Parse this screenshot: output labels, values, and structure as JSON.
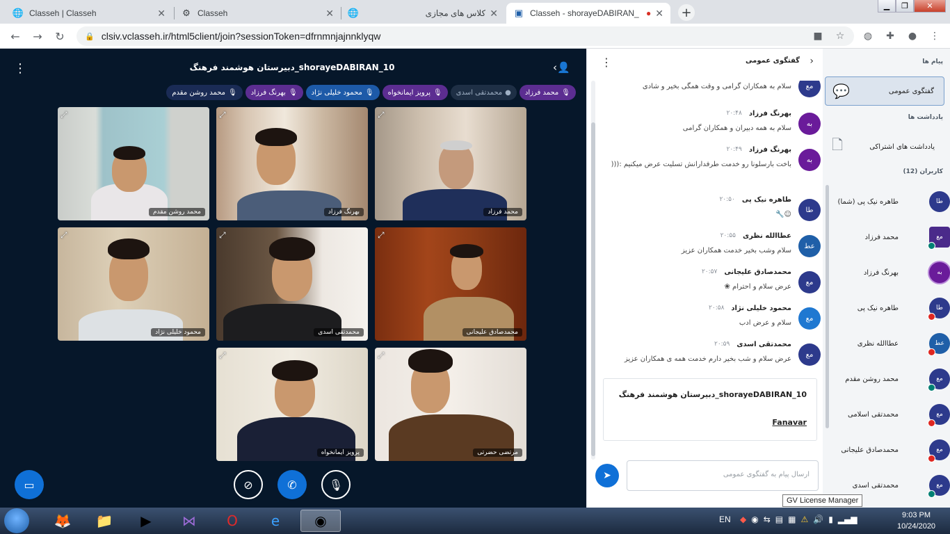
{
  "browser": {
    "tabs": [
      {
        "title": "Classeh | Classeh",
        "icon": "globe-icon"
      },
      {
        "title": "Classeh",
        "icon": "classeh-icon"
      },
      {
        "title": "کلاس های مجازی",
        "icon": "globe-icon"
      },
      {
        "title": "Classeh - shorayeDABIRAN_",
        "icon": "classeh-icon",
        "active": true,
        "recording": true
      }
    ],
    "url": "clsiv.vclasseh.ir/html5client/join?sessionToken=dfrnmnjajnnklyqw"
  },
  "session": {
    "title": "shorayeDABIRAN_10_دبیرستان هوشمند فرهنگ"
  },
  "talkers": [
    {
      "name": "محمد فرزاد",
      "style": "purple"
    },
    {
      "name": "محمدتقی اسدی",
      "style": "muted"
    },
    {
      "name": "پرویز ایمانخواه",
      "style": "purple"
    },
    {
      "name": "محمود خلیلی نژاد",
      "style": "dark-blue"
    },
    {
      "name": "بهرنگ فرزاد",
      "style": "purple"
    },
    {
      "name": "محمد روشن مقدم",
      "style": "dark"
    }
  ],
  "videos": [
    {
      "name": "محمد روشن مقدم"
    },
    {
      "name": "بهرنگ فرزاد"
    },
    {
      "name": "محمد فرزاد"
    },
    {
      "name": "محمود خلیلی نژاد"
    },
    {
      "name": "محمدتقی اسدی"
    },
    {
      "name": "محمدصادق علیجانی"
    },
    {
      "name": "پرویز ایمانخواه"
    },
    {
      "name": "مرتضی حضرتی"
    }
  ],
  "chat": {
    "title": "گفتگوی عمومی",
    "messages": [
      {
        "avatar": "مع",
        "sender": "",
        "time": "",
        "text": "سلام به همکاران گرامی و وقت همگی بخیر و شادی"
      },
      {
        "avatar": "به",
        "sender": "بهرنگ فرزاد",
        "time": "۲۰:۴۸",
        "text": "سلام به همه دبیران و همکاران گرامی"
      },
      {
        "avatar": "به",
        "sender": "بهرنگ فرزاد",
        "time": "۲۰:۴۹",
        "text": "باخت بارسلونا رو خدمت طرفدارانش تسلیت عرض میکنیم :((("
      },
      {
        "avatar": "طا",
        "sender": "طاهره نیک پی",
        "time": "۲۰:۵۰",
        "text": "☺🔧"
      },
      {
        "avatar": "عط",
        "sender": "عطاالله نظری",
        "time": "۲۰:۵۵",
        "text": "سلام وشب بخیر خدمت همکاران عزیز"
      },
      {
        "avatar": "مع",
        "sender": "محمدصادق علیجانی",
        "time": "۲۰:۵۷",
        "text": "عرض سلام و احترام ❀"
      },
      {
        "avatar": "مع",
        "sender": "محمود خلیلی نژاد",
        "time": "۲۰:۵۸",
        "text": "سلام و عرض ادب"
      },
      {
        "avatar": "مع",
        "sender": "محمدتقی اسدی",
        "time": "۲۰:۵۹",
        "text": "عرض سلام و شب بخیر دارم خدمت همه ی همکاران عزیز"
      }
    ],
    "welcome_title": "shorayeDABIRAN_10_دبیرستان هوشمند فرهنگ",
    "welcome_link": "Fanavar",
    "input_placeholder": "ارسال پیام به گفتگوی عمومی"
  },
  "users_panel": {
    "messages_heading": "پیام ها",
    "public_chat": "گفتگوی عمومی",
    "notes_heading": "یادداشت ها",
    "shared_notes": "یادداشت های اشتراکی",
    "users_heading": "کاربران (12)",
    "users": [
      {
        "avatar": "طا",
        "name": "طاهره نیک پی (شما)",
        "color": "#2d3a8c",
        "badge": ""
      },
      {
        "avatar": "مع",
        "name": "محمد فرزاد",
        "color": "#4a2a8a",
        "badge": "on"
      },
      {
        "avatar": "به",
        "name": "بهرنگ فرزاد",
        "color": "#6a1b9a",
        "badge": ""
      },
      {
        "avatar": "طا",
        "name": "طاهره نیک پی",
        "color": "#2d3a8c",
        "badge": "off"
      },
      {
        "avatar": "عط",
        "name": "عطاالله نظری",
        "color": "#1f5fa8",
        "badge": "off"
      },
      {
        "avatar": "مع",
        "name": "محمد روشن مقدم",
        "color": "#2d3a8c",
        "badge": "on"
      },
      {
        "avatar": "مع",
        "name": "محمدتقی اسلامی",
        "color": "#2d3a8c",
        "badge": "off"
      },
      {
        "avatar": "مع",
        "name": "محمدصادق علیجانی",
        "color": "#2d3a8c",
        "badge": "off"
      },
      {
        "avatar": "مع",
        "name": "محمدتقی اسدی",
        "color": "#2d3a8c",
        "badge": "on"
      }
    ]
  },
  "tooltip": "GV License Manager",
  "taskbar": {
    "lang": "EN",
    "time": "9:03 PM",
    "date": "10/24/2020"
  },
  "colors": {
    "video_bg": "#06172a",
    "accent_blue": "#0f70d7",
    "talker_purple": "#5c2d91",
    "badge_online": "#008074",
    "badge_muted": "#df2721"
  }
}
